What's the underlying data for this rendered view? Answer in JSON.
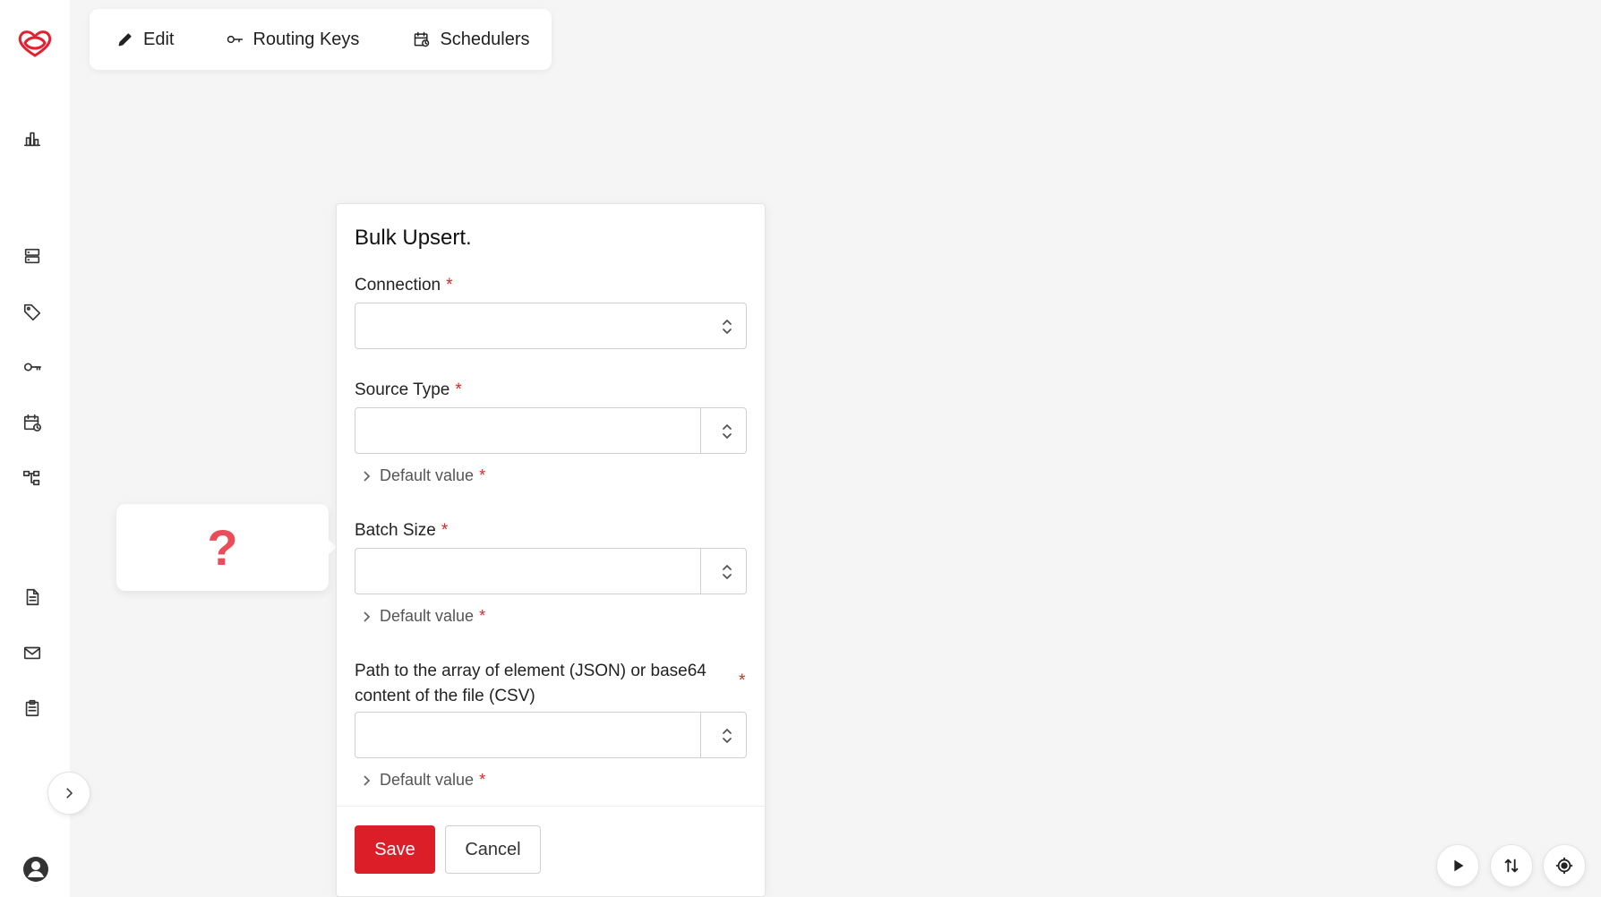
{
  "toolbar": {
    "edit_label": "Edit",
    "routing_keys_label": "Routing Keys",
    "schedulers_label": "Schedulers"
  },
  "sidebar": {
    "items": [
      {
        "icon": "bar-chart-icon"
      },
      {
        "icon": "server-icon"
      },
      {
        "icon": "tag-icon"
      },
      {
        "icon": "key-icon"
      },
      {
        "icon": "calendar-clock-icon"
      },
      {
        "icon": "hierarchy-icon"
      },
      {
        "icon": "document-icon"
      },
      {
        "icon": "mail-icon"
      },
      {
        "icon": "clipboard-icon"
      }
    ],
    "expand_icon": "chevron-right-icon",
    "profile_icon": "user-circle-icon"
  },
  "node": {
    "symbol": "?"
  },
  "panel": {
    "title": "Bulk Upsert.",
    "connection_label": "Connection",
    "source_type_label": "Source Type",
    "batch_size_label": "Batch Size",
    "path_label": "Path to the array of element (JSON) or base64 content of the file (CSV)",
    "default_value_label": "Default value",
    "required_mark": "*",
    "save_label": "Save",
    "cancel_label": "Cancel"
  },
  "controls": {
    "play_icon": "play-icon",
    "sort_icon": "sort-arrows-icon",
    "target_icon": "target-icon"
  },
  "colors": {
    "accent": "#dc1e28",
    "node_question": "#ea4c5a",
    "background": "#f5f5f5"
  }
}
